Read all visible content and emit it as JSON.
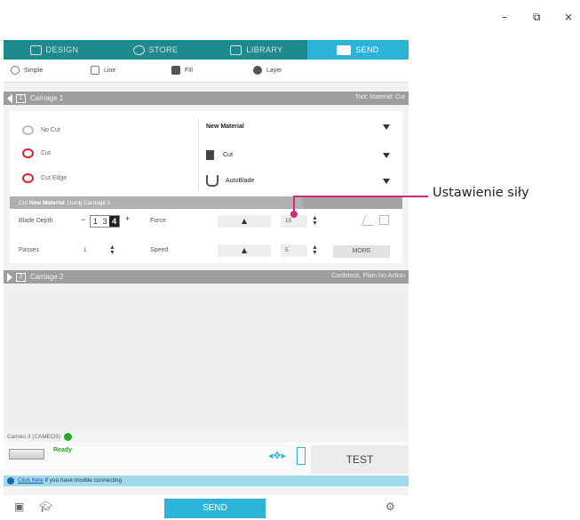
{
  "window": {
    "minimize": "–",
    "restore": "⧉",
    "close": "×"
  },
  "nav": {
    "tabs": [
      {
        "label": "DESIGN",
        "icon": "design-icon",
        "active": false
      },
      {
        "label": "STORE",
        "icon": "store-icon",
        "active": false
      },
      {
        "label": "LIBRARY",
        "icon": "library-icon",
        "active": false
      },
      {
        "label": "SEND",
        "icon": "send-cutter-icon",
        "active": true
      }
    ]
  },
  "modes": [
    {
      "label": "Simple",
      "icon": "simple-radio-icon"
    },
    {
      "label": "Line",
      "icon": "line-icon"
    },
    {
      "label": "Fill",
      "icon": "fill-icon"
    },
    {
      "label": "Layer",
      "icon": "layer-icon"
    }
  ],
  "carriage1": {
    "number": "1",
    "label": "Carriage 1",
    "right_text": "Tool: Material: Cut"
  },
  "tools": [
    {
      "label": "No Cut",
      "icon": "no-cut-icon"
    },
    {
      "label": "Cut",
      "icon": "cut-icon"
    },
    {
      "label": "Cut Edge",
      "icon": "cut-edge-icon"
    }
  ],
  "material": {
    "material_label": "New Material",
    "action_label": "Cut",
    "tool_label": "AutoBlade"
  },
  "cut_bar": {
    "prefix": "Cut",
    "material": "New Material",
    "suffix": "Using Carriage 1"
  },
  "settings": {
    "blade_depth_label": "Blade Depth",
    "blade_depth_digits": [
      "1",
      "3",
      "4"
    ],
    "minus": "−",
    "plus": "+",
    "force_label": "Force",
    "force_value": "15",
    "passes_label": "Passes",
    "passes_value": "1",
    "speed_label": "Speed",
    "speed_value": "5",
    "more_label": "MORE"
  },
  "carriage2": {
    "number": "2",
    "label": "Carriage 2",
    "right_text": "Cardstock, Plain No Action"
  },
  "connection": {
    "label": "Cameo 3 (CAMEO3)"
  },
  "status": {
    "ready": "Ready",
    "test_label": "TEST"
  },
  "help": {
    "link": "Click here",
    "text": " if you have trouble connecting"
  },
  "send_label": "SEND",
  "callout": {
    "text": "Ustawienie siły"
  },
  "colors": {
    "accent": "#2cb3d8",
    "nav_bg": "#1e8a8e",
    "cut_red": "#d8232a",
    "callout": "#d4287c"
  }
}
